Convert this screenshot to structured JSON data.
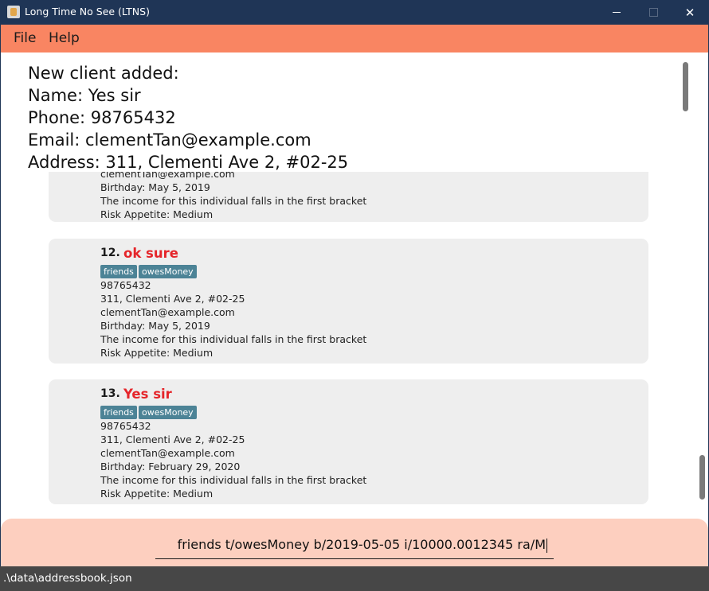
{
  "window": {
    "title": "Long Time No See (LTNS)",
    "minimize_glyph": "—",
    "close_glyph": "✕"
  },
  "menu": {
    "file": "File",
    "help": "Help"
  },
  "result": {
    "lines": [
      "New client added:",
      "Name: Yes sir",
      "Phone: 98765432",
      "Email: clementTan@example.com",
      "Address: 311, Clementi Ave 2, #02-25"
    ]
  },
  "persons": [
    {
      "index": "",
      "name": "",
      "tags": [],
      "phone": "",
      "address": "",
      "email": "clementTan@example.com",
      "birthday": "Birthday: May 5, 2019",
      "income": "The income for this individual falls in the first bracket",
      "risk": "Risk Appetite: Medium"
    },
    {
      "index": "12.",
      "name": "ok sure",
      "tags": [
        "friends",
        "owesMoney"
      ],
      "phone": "98765432",
      "address": "311, Clementi Ave 2, #02-25",
      "email": "clementTan@example.com",
      "birthday": "Birthday: May 5, 2019",
      "income": "The income for this individual falls in the first bracket",
      "risk": "Risk Appetite: Medium"
    },
    {
      "index": "13.",
      "name": "Yes sir",
      "tags": [
        "friends",
        "owesMoney"
      ],
      "phone": "98765432",
      "address": "311, Clementi Ave 2, #02-25",
      "email": "clementTan@example.com",
      "birthday": "Birthday: February 29, 2020",
      "income": "The income for this individual falls in the first bracket",
      "risk": "Risk Appetite: Medium"
    }
  ],
  "command": {
    "value": "friends t/owesMoney b/2019-05-05 i/10000.0012345 ra/M"
  },
  "status": {
    "path": ".\\data\\addressbook.json"
  },
  "colors": {
    "titlebar": "#1f3556",
    "menubar": "#f98562",
    "command_area": "#fdcfbf",
    "name_red": "#e5252a",
    "tag_bg": "#4c8396",
    "card_bg": "#eeeeee",
    "statusbar": "#474747"
  },
  "icons": {
    "app": "app-icon",
    "minimize": "minimize-icon",
    "maximize": "maximize-icon",
    "close": "close-icon"
  }
}
